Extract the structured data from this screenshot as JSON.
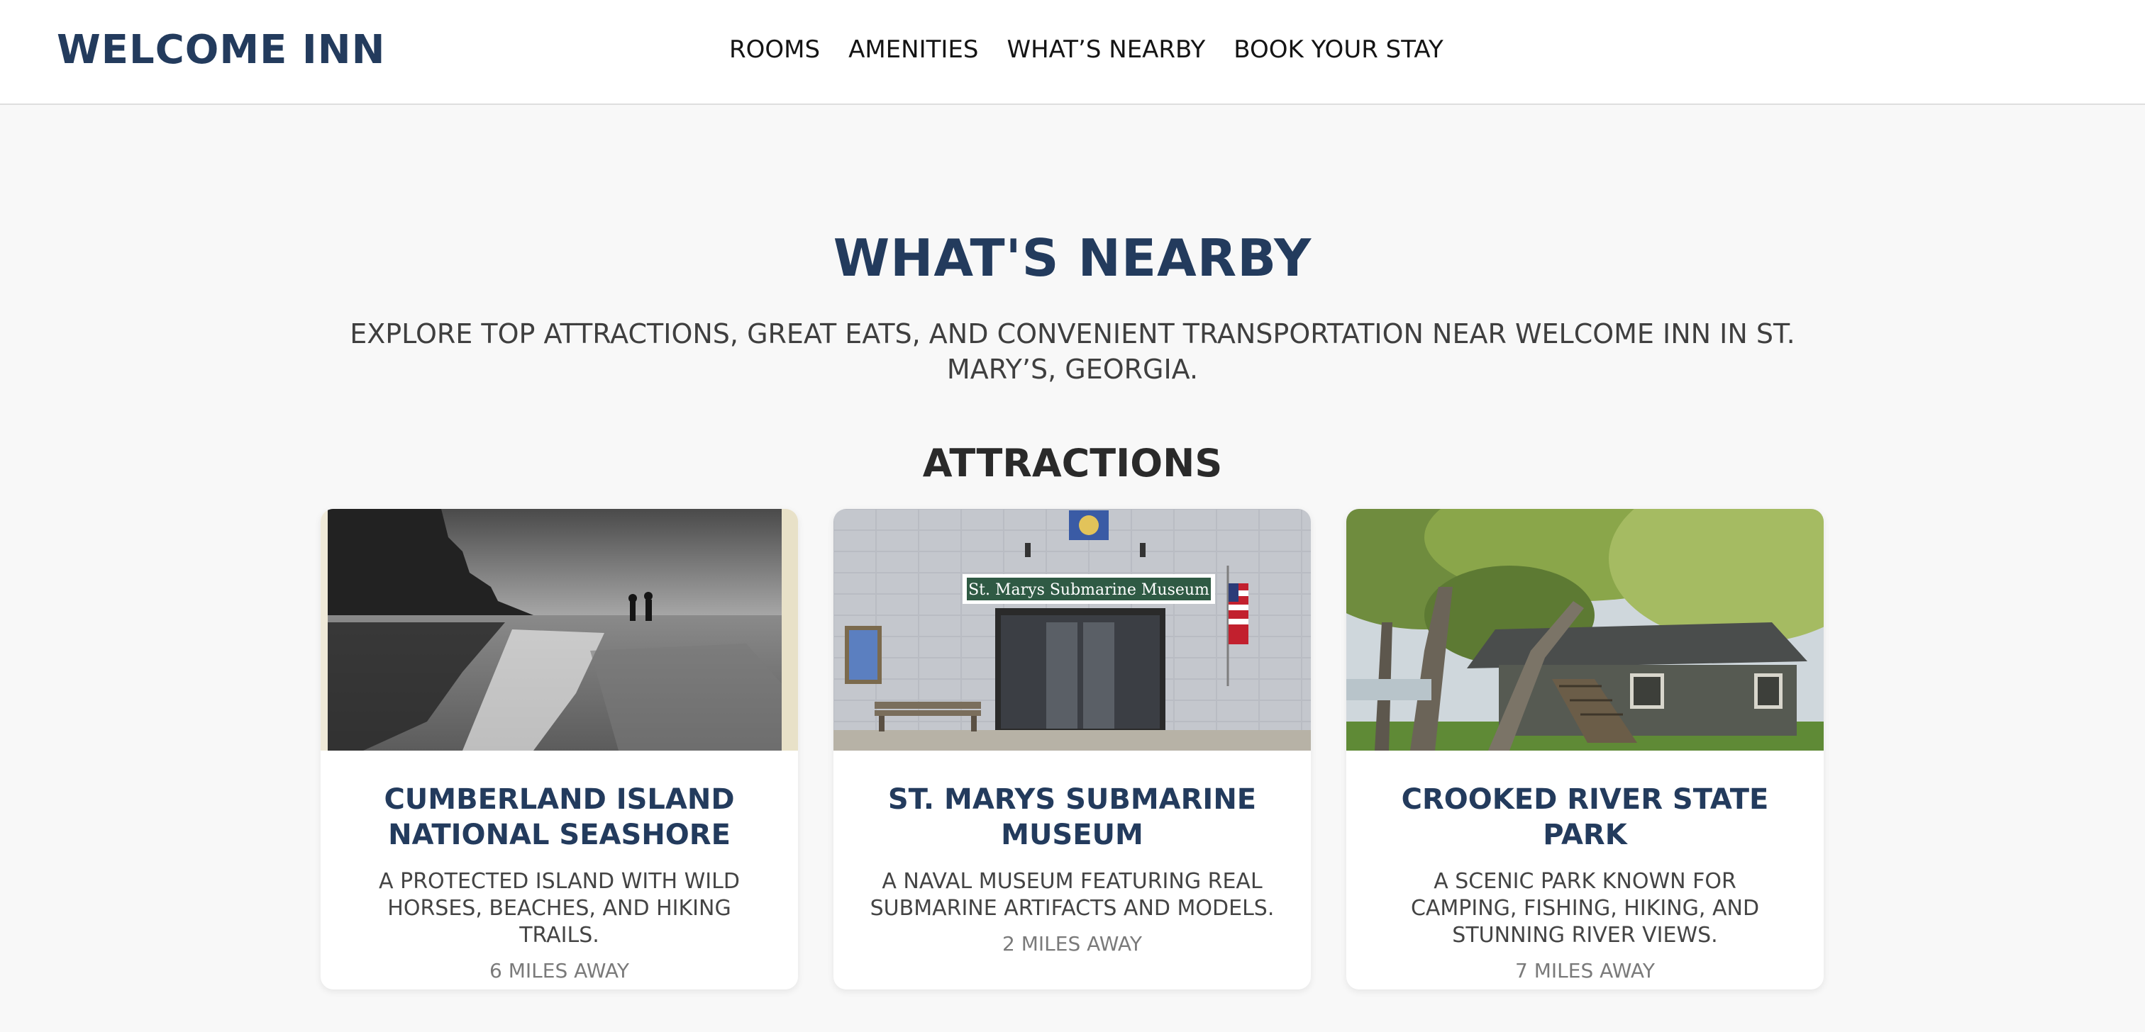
{
  "header": {
    "logo": "WELCOME INN",
    "nav": [
      {
        "label": "ROOMS"
      },
      {
        "label": "AMENITIES"
      },
      {
        "label": "WHAT’S NEARBY"
      },
      {
        "label": "BOOK YOUR STAY"
      }
    ]
  },
  "main": {
    "title": "WHAT'S NEARBY",
    "intro": "EXPLORE TOP ATTRACTIONS, GREAT EATS, AND CONVENIENT TRANSPORTATION NEAR WELCOME INN IN ST. MARY’S, GEORGIA.",
    "attractions": {
      "heading": "ATTRACTIONS",
      "cards": [
        {
          "title": "CUMBERLAND ISLAND NATIONAL SEASHORE",
          "description": "A PROTECTED ISLAND WITH WILD HORSES, BEACHES, AND HIKING TRAILS.",
          "distance": "6 MILES AWAY",
          "image": "beach-photo"
        },
        {
          "title": "ST. MARYS SUBMARINE MUSEUM",
          "description": "A NAVAL MUSEUM FEATURING REAL SUBMARINE ARTIFACTS AND MODELS.",
          "distance": "2 MILES AWAY",
          "image": "museum-photo",
          "sign_text": "St. Marys Submarine Museum"
        },
        {
          "title": "CROOKED RIVER STATE PARK",
          "description": "A SCENIC PARK KNOWN FOR CAMPING, FISHING, HIKING, AND STUNNING RIVER VIEWS.",
          "distance": "7 MILES AWAY",
          "image": "park-cabin-photo"
        }
      ]
    }
  },
  "colors": {
    "brand": "#233b5d",
    "page_background": "#f8f8f8",
    "header_background": "#ffffff"
  }
}
